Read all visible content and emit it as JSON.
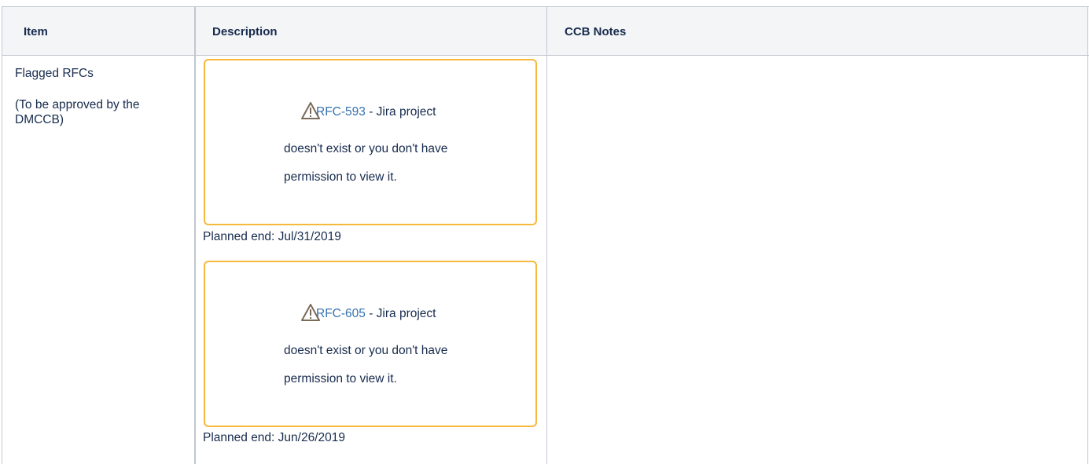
{
  "table": {
    "headers": {
      "item": "Item",
      "description": "Description",
      "notes": "CCB Notes"
    },
    "row": {
      "item_title": "Flagged RFCs",
      "item_note_line1": "(To be approved by the",
      "item_note_line2": "DMCCB)",
      "rfcs": [
        {
          "key": "RFC-593",
          "msg_suffix": " - Jira project",
          "msg_line2": "doesn't exist or you don't have",
          "msg_line3": "permission to view it.",
          "planned_end": "Planned end: Jul/31/2019"
        },
        {
          "key": "RFC-605",
          "msg_suffix": " - Jira project",
          "msg_line2": "doesn't exist or you don't have",
          "msg_line3": "permission to view it.",
          "planned_end": "Planned end: Jun/26/2019"
        }
      ],
      "ccb_notes": ""
    }
  },
  "colors": {
    "border": "#c1c7d0",
    "header_bg": "#f4f5f7",
    "link": "#3572b0",
    "warning_border": "#f6b93b",
    "icon": "warning-icon"
  }
}
